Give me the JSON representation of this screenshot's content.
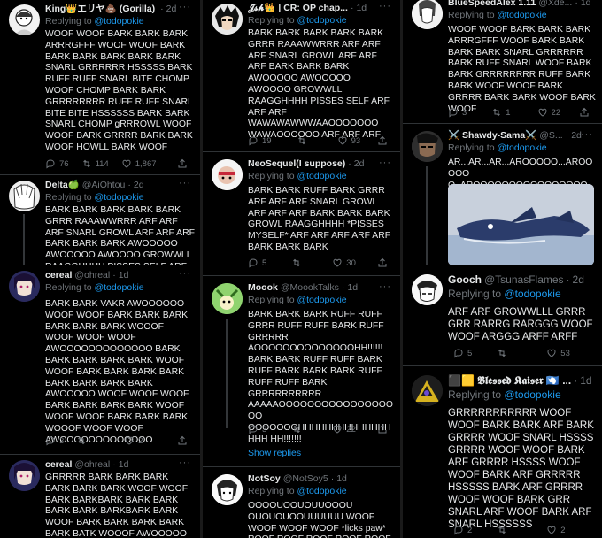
{
  "col1": [
    {
      "name": "King👑エリヤ💩 (Gorilla)",
      "handle": "",
      "time": "2d",
      "reply_prefix": "Replying to",
      "reply_to": "@todopokie",
      "text": "WOOF WOOF BARK BARK BARK ARRRGFFF WOOF WOOF BARK BARK BARK BARK BARK BARK SNARL GRRRRRR HSSSSS BARK RUFF RUFF SNARL BITE CHOMP WOOF CHOMP BARK BARK GRRRRRRRR RUFF RUFF SNARL BITE BITE HSSSSSS BARK BARK SNARL CHOMP gRRROWL WOOF WOOF BARK GRRRR BARK BARK WOOF HOWLL BARK WOOF",
      "replies": "76",
      "retweets": "114",
      "likes": "1,867"
    },
    {
      "name": "Delta🍏",
      "handle": "@AiOhtou",
      "time": "2d",
      "reply_prefix": "Replying to",
      "reply_to": "@todopokie",
      "text": "BARK BARK BARK BARK BARK GRRR RAAAWWRRR ARF ARF ARF SNARL GROWL ARF ARF ARF BARK BARK BARK AWOOOOO AWOOOOO AWOOOO GROWWLL RAAGGHHHH PISSES SELF ARF"
    },
    {
      "name": "cereal",
      "handle": "@ohreal",
      "time": "1d",
      "reply_prefix": "Replying to",
      "reply_to": "@todopokie",
      "text": "BARK BARK VAKR AWOOOOOO WOOF WOOF BARK BARK BARK BARK BARK BARK WOOOF WOOF WOOF WOOF AWOOOOOOOOOOOOO BARK BARK BARK BARK BARK WOOF WOOF BARK BARK BARK BARK BARK BARK BARK BARK AWOOOOO WOOF WOOF WOOF BARK BARK BARK BARK WOOF WOOF WOOF BARK BARK BARK WOOOF WOOF WOOF AWOOOOOOOOOOOOO",
      "replies": "3",
      "retweets": "",
      "likes": "2"
    },
    {
      "name": "cereal",
      "handle": "@ohreal",
      "time": "1d",
      "text": "GRRRRR BARK BARK BARK BARK BARK BARK WOOF WOOF BARK BARKBARK BARK BARK BARK BARK BARKBARK BARK WOOF BARK BARK BARK BARK BARK BATK WOOOF AWOOOOO"
    }
  ],
  "col2": [
    {
      "name": "𝓙𝓼𝓱👑 | CR: OP chap...",
      "handle": "",
      "time": "1d",
      "reply_prefix": "Replying to",
      "reply_to": "@todopokie",
      "text": "BARK BARK BARK BARK BARK GRRR RAAAWWRRR ARF ARF ARF SNARL GROWL ARF ARF ARF BARK BARK BARK AWOOOOO AWOOOOO AWOOOO GROWWLL RAAGGHHHH PISSES SELF ARF ARF ARF WAWAWAWWWAAOOOOOOO WAWAOOOOOO ARF ARF ARF",
      "replies": "19",
      "retweets": "",
      "likes": "93"
    },
    {
      "name": "NeoSequel(I suppose)",
      "handle": "",
      "time": "2d",
      "reply_prefix": "Replying to",
      "reply_to": "@todopokie",
      "text": "BARK BARK RUFF BARK GRRR ARF ARF ARF SNARL GROWL ARF ARF ARF BARK BARK BARK GROWL RAAGGHHHH *PISSES MYSELF* ARF ARF ARF ARF ARF BARK BARK BARK",
      "replies": "5",
      "retweets": "",
      "likes": "30"
    },
    {
      "name": "Moook",
      "handle": "@MoookTalks",
      "time": "1d",
      "reply_prefix": "Replying to",
      "reply_to": "@todopokie",
      "text": "BARK BARK BARK RUFF RUFF GRRR RUFF RUFF BARK RUFF GRRRRR AOOOOOOOOOOOOOOHH!!!!!! BARK BARK RUFF RUFF BARK RUFF BARK BARK BARK RUFF RUFF RUFF BARK GRRRRRRRRRR AAAAAOOOOOOOOOOOOOOOOOO OOOOOOOHHHHHHHHHHHHHHHHH HH!!!!!!!",
      "replies": "3",
      "retweets": "",
      "likes": "22",
      "show_replies": "Show replies"
    },
    {
      "name": "NotSoy",
      "handle": "@NotSoy5",
      "time": "1d",
      "reply_prefix": "Replying to",
      "reply_to": "@todopokie",
      "text": "OOOOUOOUOUUOOOU OUOUOUOOUUUUUU WOOF WOOF WOOF WOOF *licks paw* ROOF ROOF ROOF ROOF ROOF"
    }
  ],
  "col3": [
    {
      "name": "BlueSpeedAlex 1.11",
      "handle": "@Xde...",
      "time": "1d",
      "text": "WOOF WOOF BARK BARK BARK ARRRGFFF WOOF BARK BARK BARK BARK SNARL GRRRRRR BARK RUFF SNARL WOOF BARK BARK GRRRRRRRR RUFF BARK BARK WOOF WOOF BARK GRRRR BARK BARK WOOF BARK WOOF",
      "replies": "3",
      "retweets": "1",
      "likes": "22"
    },
    {
      "name": "⚔️ Shawdy-Sama⚔️",
      "handle": "@S...",
      "time": "2d",
      "reply_prefix": "Replying to",
      "reply_to": "@todopokie",
      "text": "AR...AR...AR...AROOOOO...AROOOOO O..AROOOOOOOOOOOOOOOO"
    },
    {
      "name": "Gooch",
      "handle": "@TsunasFlames",
      "time": "2d",
      "reply_prefix": "Replying to",
      "reply_to": "@todopokie",
      "text": "ARF ARF GROWWLLL GRRR GRR RARRG RARGGG WOOF WOOF ARGGG ARFF ARFF",
      "replies": "5",
      "retweets": "",
      "likes": "53"
    },
    {
      "name": "⬛🟨 𝕭𝖑𝖊𝖘𝖘𝖊𝖉 𝕶𝖆𝖎𝖘𝖊𝖗 🇦🇶 ...",
      "handle": "",
      "time": "1d",
      "reply_prefix": "Replying to",
      "reply_to": "@todopokie",
      "text": "GRRRRRRRRRRR WOOF WOOF BARK BARK ARF BARK GRRRR WOOF SNARL HSSSS GRRRR WOOF WOOF BARK ARF GRRRR HSSSS WOOF WOOF BARK ARF GRRRRR HSSSSS BARK ARF GRRRR WOOF WOOF BARK GRR SNARL ARF WOOF BARK ARF SNARL HSSSSSS",
      "replies": "2",
      "retweets": "",
      "likes": "2"
    }
  ],
  "icons": {
    "reply": "reply-icon",
    "retweet": "retweet-icon",
    "like": "heart-icon",
    "share": "share-icon",
    "more": "more-icon"
  },
  "colors": {
    "background": "#000000",
    "text": "#e7e9ea",
    "muted": "#71767b",
    "accent": "#1d9bf0",
    "border": "#2f3336"
  }
}
